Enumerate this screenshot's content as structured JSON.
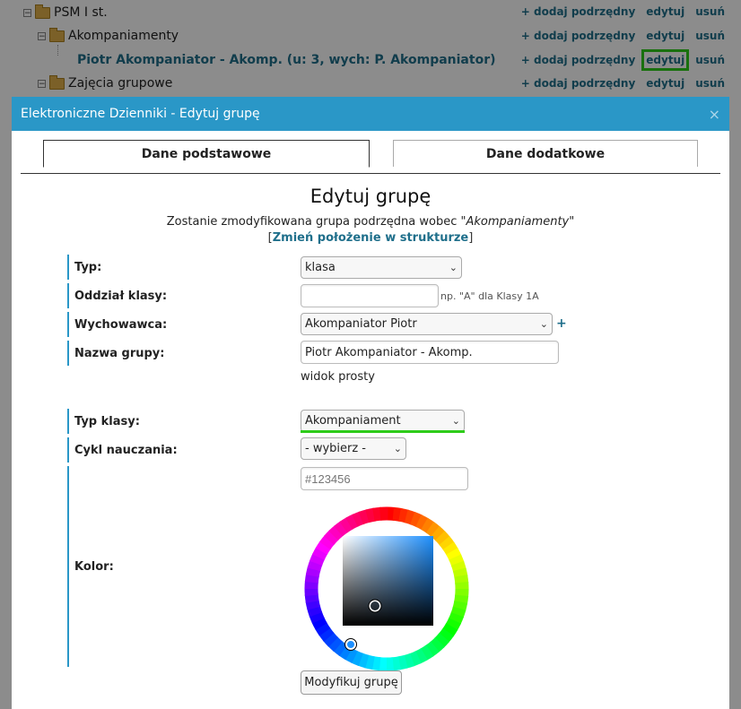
{
  "tree": {
    "rows": [
      {
        "label": "PSM I st.",
        "type": "folder"
      },
      {
        "label": "Akompaniamenty",
        "type": "folder"
      },
      {
        "label": "Piotr Akompaniator - Akomp. (u: 3, wych: P. Akompaniator)",
        "type": "link"
      },
      {
        "label": "Zajęcia grupowe",
        "type": "folder"
      }
    ],
    "action_add": "+ dodaj podrzędny",
    "action_edit": "edytuj",
    "action_delete": "usuń",
    "expander_symbol": "⊟"
  },
  "dialog": {
    "title": "Elektroniczne Dzienniki - Edytuj grupę",
    "close": "×",
    "tabs": [
      "Dane podstawowe",
      "Dane dodatkowe"
    ],
    "heading": "Edytuj grupę",
    "subtext_prefix": "Zostanie zmodyfikowana grupa podrzędna wobec \"",
    "subtext_group": "Akompaniamenty",
    "subtext_suffix": "\"",
    "relink_open": "[",
    "relink_label": "Zmień położenie w strukturze",
    "relink_close": "]"
  },
  "form": {
    "typ_label": "Typ:",
    "typ_value": "klasa",
    "oddzial_label": "Oddział klasy:",
    "oddzial_value": "",
    "oddzial_hint": "np. \"A\" dla Klasy 1A",
    "wychowawca_label": "Wychowawca:",
    "wychowawca_value": "Akompaniator Piotr",
    "wychowawca_add": "+",
    "nazwa_label": "Nazwa grupy:",
    "nazwa_value": "Piotr Akompaniator - Akomp.",
    "widok_text": "widok prosty",
    "typ_klasy_label": "Typ klasy:",
    "typ_klasy_value": "Akompaniament",
    "cykl_label": "Cykl nauczania:",
    "cykl_value": "- wybierz -",
    "kolor_label": "Kolor:",
    "kolor_placeholder": "#123456",
    "submit_label": "Modyfikuj grupę"
  },
  "colors": {
    "accent": "#2a97c7",
    "link": "#1f6f8b",
    "highlight": "#2ecc1a",
    "picked": "#1e90ff"
  }
}
